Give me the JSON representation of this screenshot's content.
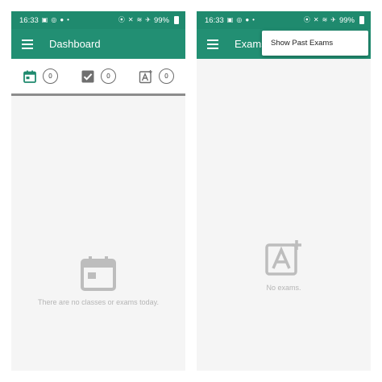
{
  "status_bar": {
    "time": "16:33",
    "battery": "99%"
  },
  "left_screen": {
    "title": "Dashboard",
    "tabs": [
      {
        "icon": "calendar-icon",
        "count": "0",
        "color": "#1f8a6e"
      },
      {
        "icon": "checkbox-icon",
        "count": "0",
        "color": "#6f6f6f"
      },
      {
        "icon": "exam-grade-icon",
        "count": "0",
        "color": "#6f6f6f"
      }
    ],
    "empty_message": "There are no classes or exams today."
  },
  "right_screen": {
    "title": "Exams",
    "menu": {
      "item_label": "Show Past Exams"
    },
    "empty_message": "No exams."
  },
  "colors": {
    "primary": "#228f73",
    "status_bar": "#1f8a6e",
    "background": "#f5f5f5",
    "empty_icon": "#bdbdbd"
  }
}
